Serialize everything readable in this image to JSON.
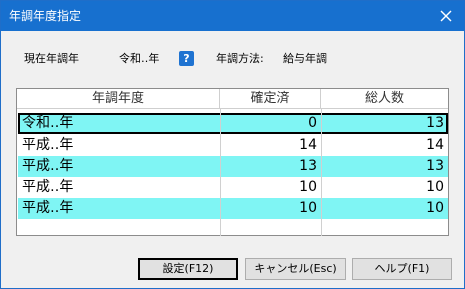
{
  "window": {
    "title": "年調年度指定"
  },
  "info": {
    "current_year_label": "現在年調年",
    "current_year_value": "令和‥年",
    "method_label": "年調方法:",
    "method_value": "給与年調"
  },
  "table": {
    "headers": [
      "年調年度",
      "確定済",
      "総人数"
    ],
    "rows": [
      {
        "year": "令和‥年",
        "confirmed": "0",
        "total": "13"
      },
      {
        "year": "平成‥年",
        "confirmed": "14",
        "total": "14"
      },
      {
        "year": "平成‥年",
        "confirmed": "13",
        "total": "13"
      },
      {
        "year": "平成‥年",
        "confirmed": "10",
        "total": "10"
      },
      {
        "year": "平成‥年",
        "confirmed": "10",
        "total": "10"
      }
    ]
  },
  "buttons": {
    "settings": "設定(F12)",
    "cancel": "キャンセル(Esc)",
    "help": "ヘルプ(F1)"
  },
  "colors": {
    "titlebar": "#1770cf",
    "row_highlight": "#7ff5f4"
  },
  "icons": {
    "help_icon_glyph": "?",
    "close_icon": "close-icon"
  }
}
